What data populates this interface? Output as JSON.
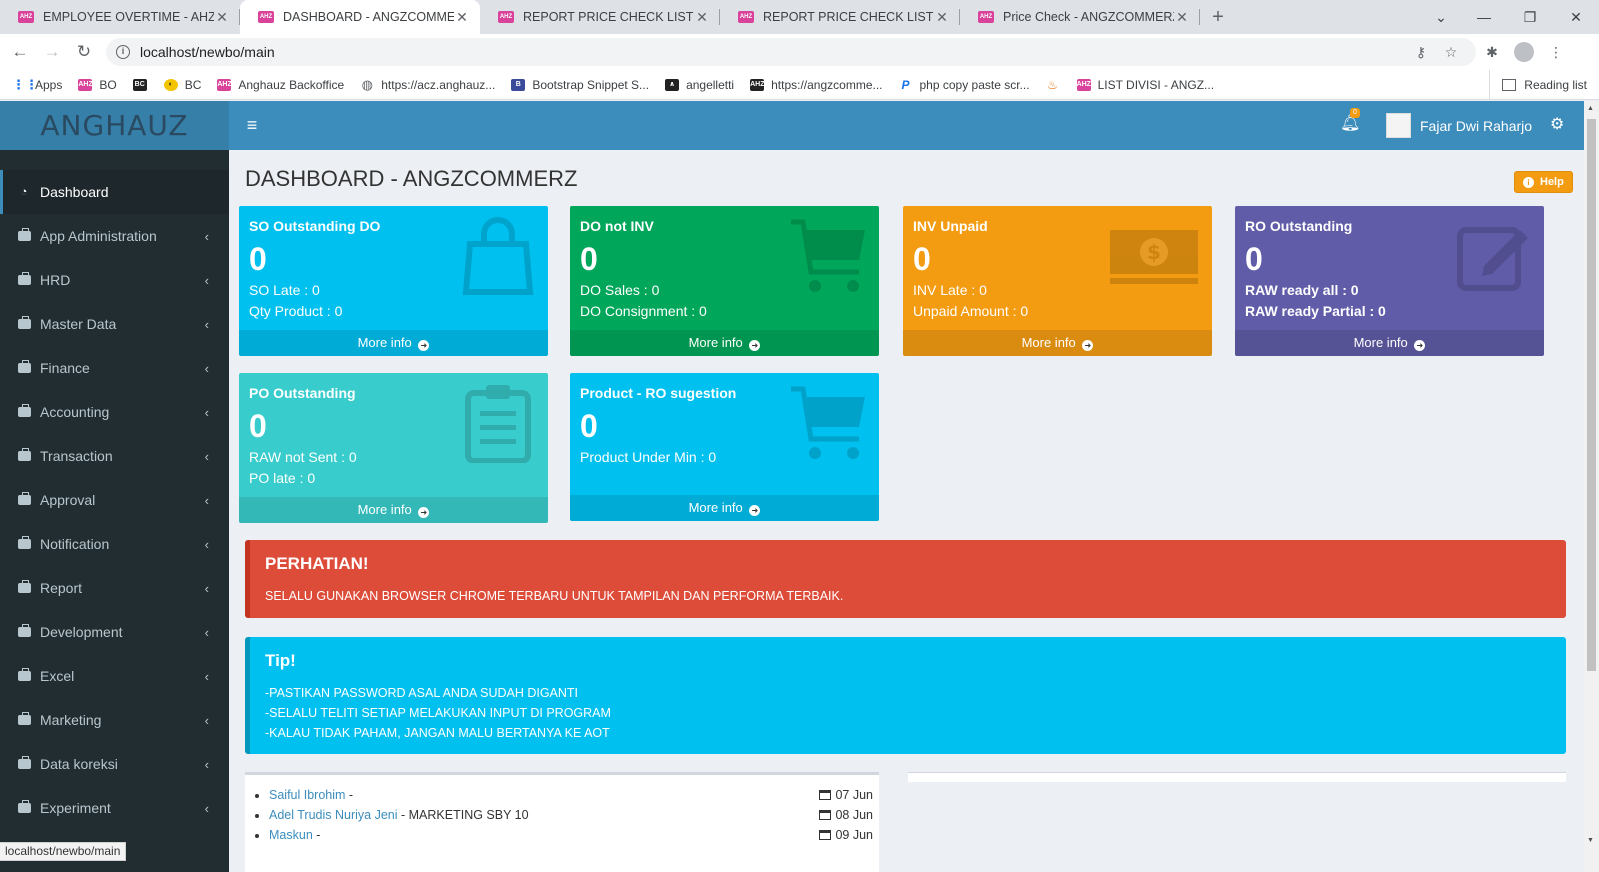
{
  "browser": {
    "tabs": [
      {
        "favicon": "AHZ",
        "title": "EMPLOYEE OVERTIME - AHZ BO",
        "active": false
      },
      {
        "favicon": "AHZ",
        "title": "DASHBOARD - ANGZCOMMERZ",
        "active": true
      },
      {
        "favicon": "AHZ",
        "title": "REPORT PRICE CHECK LIST - ANG",
        "active": false
      },
      {
        "favicon": "AHZ",
        "title": "REPORT PRICE CHECK LIST - ANG",
        "active": false
      },
      {
        "favicon": "AHZ",
        "title": "Price Check - ANGZCOMMERZ",
        "active": false
      }
    ],
    "url": "localhost/newbo/main",
    "bookmarks": [
      {
        "icon": "apps-grid-icon",
        "label": "Apps"
      },
      {
        "icon": "ahz-icon",
        "label": "BO"
      },
      {
        "icon": "bc-icon",
        "label": ""
      },
      {
        "icon": "bc-yellow-icon",
        "label": "BC"
      },
      {
        "icon": "ahz-icon",
        "label": "Anghauz Backoffice"
      },
      {
        "icon": "globe-icon",
        "label": "https://acz.anghauz..."
      },
      {
        "icon": "bootstrap-icon",
        "label": "Bootstrap Snippet S..."
      },
      {
        "icon": "angelletti-icon",
        "label": "angelletti"
      },
      {
        "icon": "anghauz-dark-icon",
        "label": "https://angzcomme..."
      },
      {
        "icon": "php-icon",
        "label": "php copy paste scr..."
      },
      {
        "icon": "fire-icon",
        "label": ""
      },
      {
        "icon": "ahz-icon",
        "label": "LIST DIVISI - ANGZ..."
      }
    ],
    "reading_list": "Reading list",
    "status_url": "localhost/newbo/main"
  },
  "app": {
    "logo": "ANGHAUZ",
    "notification_count": "0",
    "user_name": "Fajar Dwi Raharjo",
    "sidebar": [
      {
        "label": "Dashboard",
        "active": true,
        "icon": "dashboard-icon"
      },
      {
        "label": "App Administration",
        "active": false,
        "icon": "briefcase-icon"
      },
      {
        "label": "HRD",
        "active": false,
        "icon": "briefcase-icon"
      },
      {
        "label": "Master Data",
        "active": false,
        "icon": "briefcase-icon"
      },
      {
        "label": "Finance",
        "active": false,
        "icon": "briefcase-icon"
      },
      {
        "label": "Accounting",
        "active": false,
        "icon": "briefcase-icon"
      },
      {
        "label": "Transaction",
        "active": false,
        "icon": "briefcase-icon"
      },
      {
        "label": "Approval",
        "active": false,
        "icon": "briefcase-icon"
      },
      {
        "label": "Notification",
        "active": false,
        "icon": "briefcase-icon"
      },
      {
        "label": "Report",
        "active": false,
        "icon": "briefcase-icon"
      },
      {
        "label": "Development",
        "active": false,
        "icon": "briefcase-icon"
      },
      {
        "label": "Excel",
        "active": false,
        "icon": "briefcase-icon"
      },
      {
        "label": "Marketing",
        "active": false,
        "icon": "briefcase-icon"
      },
      {
        "label": "Data koreksi",
        "active": false,
        "icon": "briefcase-icon"
      },
      {
        "label": "Experiment",
        "active": false,
        "icon": "briefcase-icon"
      }
    ],
    "page_title": "DASHBOARD - ANGZCOMMERZ",
    "help_label": "Help",
    "more_info": "More info",
    "boxes": [
      {
        "title": "SO Outstanding DO",
        "value": "0",
        "line1": "SO Late : 0",
        "line2": "Qty Product : 0",
        "color": "#00c0ef",
        "icon": "shopping-bag-icon",
        "bold_lines": false
      },
      {
        "title": "DO not INV",
        "value": "0",
        "line1": "DO Sales : 0",
        "line2": "DO Consignment : 0",
        "color": "#00a65a",
        "icon": "cart-icon",
        "bold_lines": false
      },
      {
        "title": "INV Unpaid",
        "value": "0",
        "line1": "INV Late : 0",
        "line2": "Unpaid Amount : 0",
        "color": "#f39c12",
        "icon": "money-icon",
        "bold_lines": false
      },
      {
        "title": "RO Outstanding",
        "value": "0",
        "line1": "RAW ready all : 0",
        "line2": "RAW ready Partial : 0",
        "color": "#605ca8",
        "icon": "edit-icon",
        "bold_lines": true
      },
      {
        "title": "PO Outstanding",
        "value": "0",
        "line1": "RAW not Sent : 0",
        "line2": "PO late : 0",
        "color": "#39cccc",
        "icon": "clipboard-icon",
        "bold_lines": false
      },
      {
        "title": "Product - RO sugestion",
        "value": "0",
        "line1": "Product Under Min : 0",
        "line2": "",
        "color": "#00c0ef",
        "icon": "cart-icon",
        "bold_lines": false
      }
    ],
    "alert": {
      "title": "PERHATIAN!",
      "text": "SELALU GUNAKAN BROWSER CHROME TERBARU UNTUK TAMPILAN DAN PERFORMA TERBAIK."
    },
    "tip": {
      "title": "Tip!",
      "lines": [
        "-PASTIKAN PASSWORD ASAL ANDA SUDAH DIGANTI",
        "-SELALU TELITI SETIAP MELAKUKAN INPUT DI PROGRAM",
        "-KALAU TIDAK PAHAM, JANGAN MALU BERTANYA KE AOT"
      ]
    },
    "birthdays": [
      {
        "name": "Saiful Ibrohim",
        "suffix": " -",
        "date": "07 Jun"
      },
      {
        "name": "Adel Trudis Nuriya Jeni",
        "suffix": " - MARKETING SBY 10",
        "date": "08 Jun"
      },
      {
        "name": "Maskun",
        "suffix": " -",
        "date": "09 Jun"
      }
    ]
  }
}
